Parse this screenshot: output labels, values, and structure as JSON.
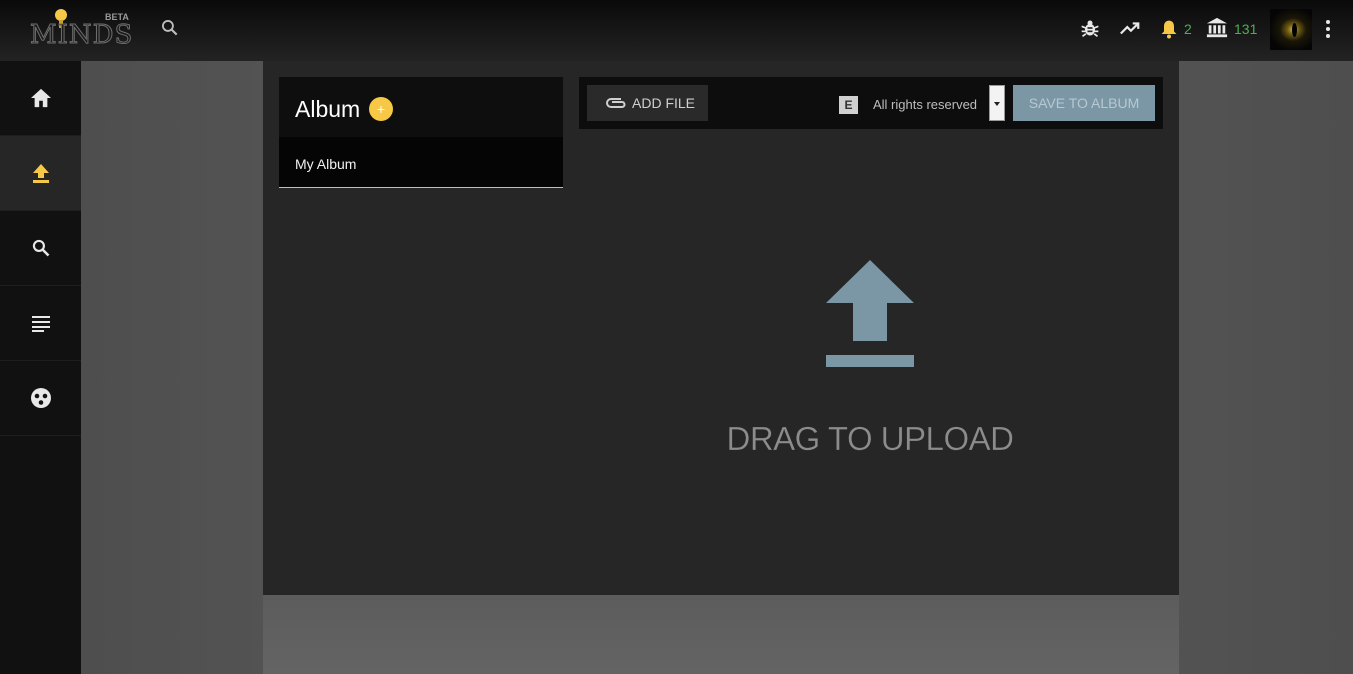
{
  "header": {
    "logo_text": "MINDS",
    "logo_badge": "BETA",
    "notifications_count": "2",
    "points_count": "131",
    "icons": [
      "bulb-icon",
      "search-icon",
      "bug-icon",
      "trending-icon",
      "bell-icon",
      "bank-icon",
      "more-vert-icon"
    ]
  },
  "sidebar": {
    "items": [
      {
        "name": "home",
        "icon": "home-icon"
      },
      {
        "name": "upload",
        "icon": "upload-icon",
        "active": true
      },
      {
        "name": "search",
        "icon": "search-icon"
      },
      {
        "name": "newsfeed",
        "icon": "subject-icon"
      },
      {
        "name": "groups",
        "icon": "group-icon"
      }
    ]
  },
  "album": {
    "title": "Album",
    "add_label": "+",
    "selected": "My Album"
  },
  "toolbar": {
    "add_file_label": "ADD FILE",
    "license_badge": "E",
    "license_text": "All rights reserved",
    "save_label": "SAVE TO ALBUM"
  },
  "dropzone": {
    "label": "DRAG TO UPLOAD"
  },
  "colors": {
    "accent_yellow": "#f7c845",
    "count_green": "#4caf50",
    "upload_blue": "#7b97a6"
  }
}
